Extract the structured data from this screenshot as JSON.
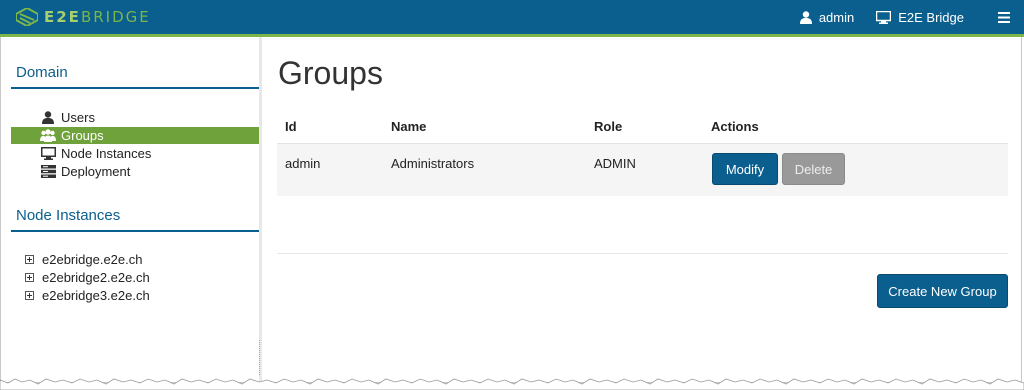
{
  "header": {
    "brand": "E2EBRIDGE",
    "brand_bold": "E2E",
    "brand_light": "BRIDGE",
    "user_label": "admin",
    "user_icon": "user-icon",
    "bridge_label": "E2E Bridge",
    "bridge_icon": "monitor-icon",
    "menu_icon": "hamburger-icon",
    "colors": {
      "bar": "#0b5f8e",
      "accent": "#7ab648"
    }
  },
  "sidebar": {
    "domain_title": "Domain",
    "domain_items": [
      {
        "label": "Users",
        "icon": "user-icon",
        "active": false
      },
      {
        "label": "Groups",
        "icon": "group-icon",
        "active": true
      },
      {
        "label": "Node Instances",
        "icon": "monitor-icon",
        "active": false
      },
      {
        "label": "Deployment",
        "icon": "server-icon",
        "active": false
      }
    ],
    "nodes_title": "Node Instances",
    "nodes": [
      {
        "label": "e2ebridge.e2e.ch"
      },
      {
        "label": "e2ebridge2.e2e.ch"
      },
      {
        "label": "e2ebridge3.e2e.ch"
      }
    ],
    "active_color": "#6fa23a"
  },
  "main": {
    "title": "Groups",
    "table": {
      "headers": [
        "Id",
        "Name",
        "Role",
        "Actions"
      ],
      "rows": [
        {
          "id": "admin",
          "name": "Administrators",
          "role": "ADMIN",
          "modify": "Modify",
          "delete": "Delete"
        }
      ]
    },
    "create_button": "Create New Group"
  }
}
